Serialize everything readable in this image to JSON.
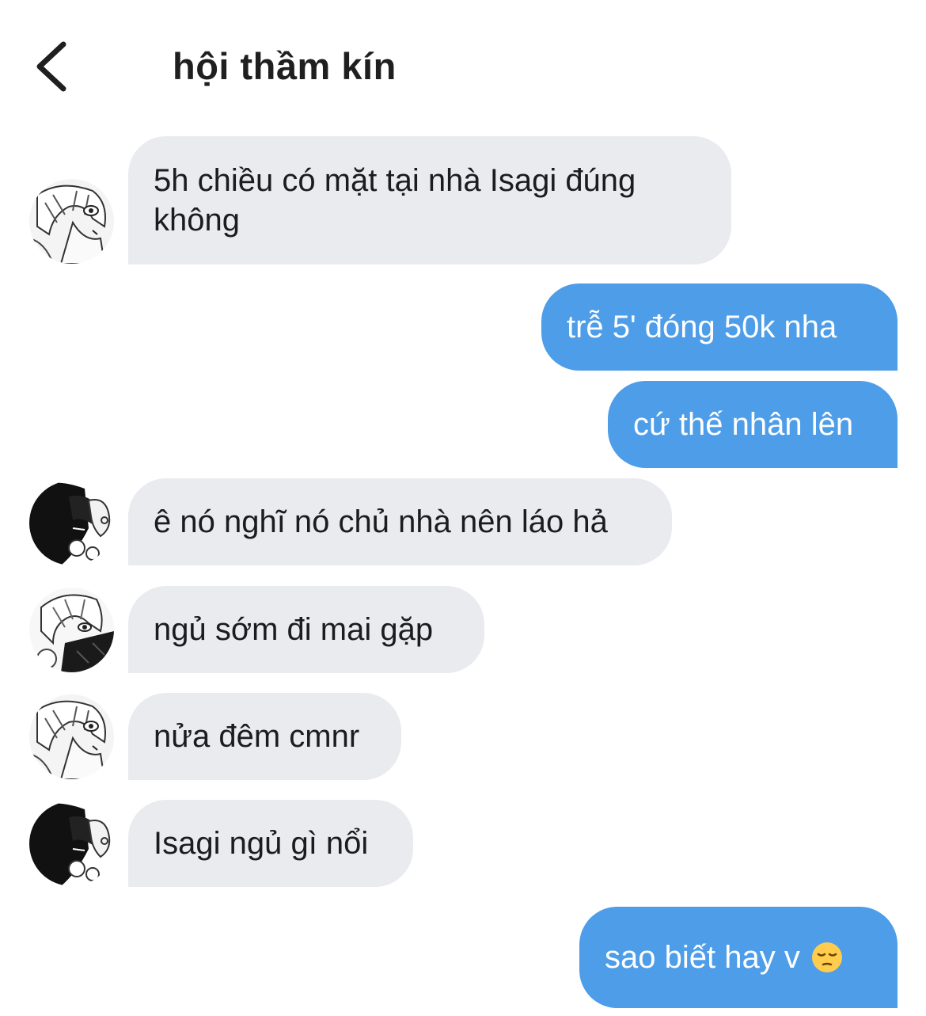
{
  "header": {
    "title": "hội thầm kín",
    "back_icon": "chevron-left-icon"
  },
  "colors": {
    "incoming_bubble": "#e9ebef",
    "outgoing_bubble": "#4d9de8",
    "title_text": "#1f1f1f"
  },
  "messages": [
    {
      "direction": "incoming",
      "avatar": "avatar-light-hair-1",
      "text": "5h chiều có mặt tại nhà Isagi đúng không"
    },
    {
      "direction": "outgoing",
      "text": "trễ 5' đóng 50k nha"
    },
    {
      "direction": "outgoing",
      "text": "cứ thế nhân lên"
    },
    {
      "direction": "incoming",
      "avatar": "avatar-dark-hair",
      "text": "ê nó nghĩ nó chủ nhà nên láo hả"
    },
    {
      "direction": "incoming",
      "avatar": "avatar-light-hair-2",
      "text": "ngủ sớm đi mai gặp"
    },
    {
      "direction": "incoming",
      "avatar": "avatar-light-hair-1",
      "text": "nửa đêm cmnr"
    },
    {
      "direction": "incoming",
      "avatar": "avatar-dark-hair",
      "text": "Isagi ngủ gì nổi"
    },
    {
      "direction": "outgoing",
      "text": "sao biết hay v",
      "emoji": "pensive-face-emoji"
    }
  ]
}
